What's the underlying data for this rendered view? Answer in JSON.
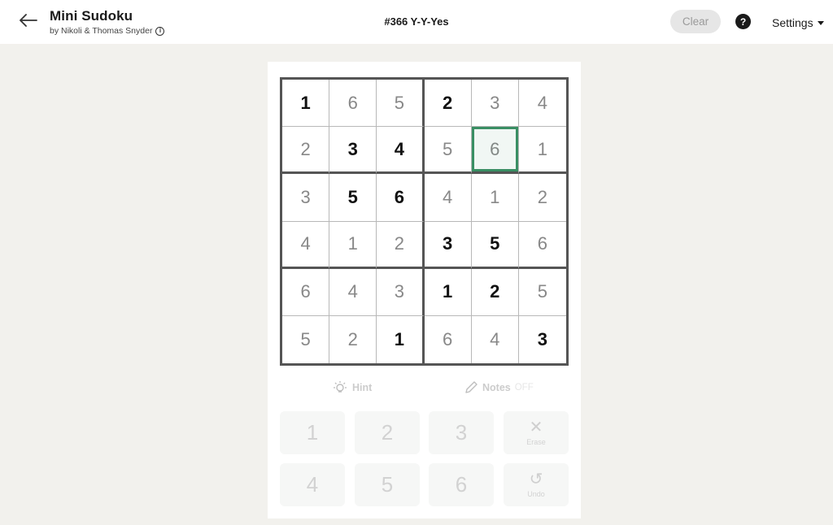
{
  "header": {
    "title": "Mini Sudoku",
    "byline": "by Nikoli & Thomas Snyder",
    "puzzle": "#366 Y-Y-Yes",
    "clear_label": "Clear",
    "help_label": "?",
    "settings_label": "Settings"
  },
  "board": {
    "selected": [
      1,
      4
    ],
    "rows": [
      [
        {
          "v": "1",
          "g": true
        },
        {
          "v": "6",
          "g": false
        },
        {
          "v": "5",
          "g": false
        },
        {
          "v": "2",
          "g": true
        },
        {
          "v": "3",
          "g": false
        },
        {
          "v": "4",
          "g": false
        }
      ],
      [
        {
          "v": "2",
          "g": false
        },
        {
          "v": "3",
          "g": true
        },
        {
          "v": "4",
          "g": true
        },
        {
          "v": "5",
          "g": false
        },
        {
          "v": "6",
          "g": false
        },
        {
          "v": "1",
          "g": false
        }
      ],
      [
        {
          "v": "3",
          "g": false
        },
        {
          "v": "5",
          "g": true
        },
        {
          "v": "6",
          "g": true
        },
        {
          "v": "4",
          "g": false
        },
        {
          "v": "1",
          "g": false
        },
        {
          "v": "2",
          "g": false
        }
      ],
      [
        {
          "v": "4",
          "g": false
        },
        {
          "v": "1",
          "g": false
        },
        {
          "v": "2",
          "g": false
        },
        {
          "v": "3",
          "g": true
        },
        {
          "v": "5",
          "g": true
        },
        {
          "v": "6",
          "g": false
        }
      ],
      [
        {
          "v": "6",
          "g": false
        },
        {
          "v": "4",
          "g": false
        },
        {
          "v": "3",
          "g": false
        },
        {
          "v": "1",
          "g": true
        },
        {
          "v": "2",
          "g": true
        },
        {
          "v": "5",
          "g": false
        }
      ],
      [
        {
          "v": "5",
          "g": false
        },
        {
          "v": "2",
          "g": false
        },
        {
          "v": "1",
          "g": true
        },
        {
          "v": "6",
          "g": false
        },
        {
          "v": "4",
          "g": false
        },
        {
          "v": "3",
          "g": true
        }
      ]
    ]
  },
  "tools": {
    "hint_label": "Hint",
    "notes_label": "Notes",
    "notes_state": "OFF"
  },
  "pad": {
    "numbers": [
      "1",
      "2",
      "3",
      "4",
      "5",
      "6"
    ],
    "erase_label": "Erase",
    "undo_label": "Undo"
  },
  "colors": {
    "selected_outline": "#3a8f64",
    "given_digit": "#111111",
    "entered_digit": "#888888",
    "background": "#f2f1ed"
  }
}
